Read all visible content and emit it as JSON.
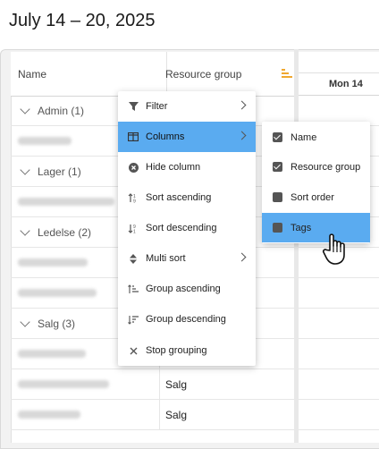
{
  "date_range": "July 14 – 20, 2025",
  "grid": {
    "columns": {
      "name": "Name",
      "resource_group": "Resource group"
    },
    "schedule_day": "Mon 14",
    "rows": [
      {
        "type": "group",
        "label": "Admin (1)",
        "group": ""
      },
      {
        "type": "person",
        "label": "",
        "group": ""
      },
      {
        "type": "group",
        "label": "Lager (1)",
        "group": ""
      },
      {
        "type": "person",
        "label": "",
        "group": ""
      },
      {
        "type": "group",
        "label": "Ledelse (2)",
        "group": ""
      },
      {
        "type": "person",
        "label": "",
        "group": ""
      },
      {
        "type": "person",
        "label": "",
        "group": ""
      },
      {
        "type": "group",
        "label": "Salg (3)",
        "group": ""
      },
      {
        "type": "person",
        "label": "",
        "group": ""
      },
      {
        "type": "person",
        "label": "",
        "group": "Salg"
      },
      {
        "type": "person",
        "label": "",
        "group": "Salg"
      }
    ]
  },
  "context_menu": {
    "items": [
      {
        "label": "Filter",
        "icon": "filter-icon"
      },
      {
        "label": "Columns",
        "icon": "columns-icon"
      },
      {
        "label": "Hide column",
        "icon": "hide-column-icon"
      },
      {
        "label": "Sort ascending",
        "icon": "sort-ascending-icon"
      },
      {
        "label": "Sort descending",
        "icon": "sort-descending-icon"
      },
      {
        "label": "Multi sort",
        "icon": "multi-sort-icon"
      },
      {
        "label": "Group ascending",
        "icon": "group-ascending-icon"
      },
      {
        "label": "Group descending",
        "icon": "group-descending-icon"
      },
      {
        "label": "Stop grouping",
        "icon": "close-icon"
      }
    ]
  },
  "columns_submenu": {
    "items": [
      {
        "label": "Name",
        "checked": true
      },
      {
        "label": "Resource group",
        "checked": true
      },
      {
        "label": "Sort order",
        "checked": false
      },
      {
        "label": "Tags",
        "checked": false
      }
    ]
  },
  "colors": {
    "highlight": "#5aabf0",
    "sort_accent": "#f0a830"
  }
}
